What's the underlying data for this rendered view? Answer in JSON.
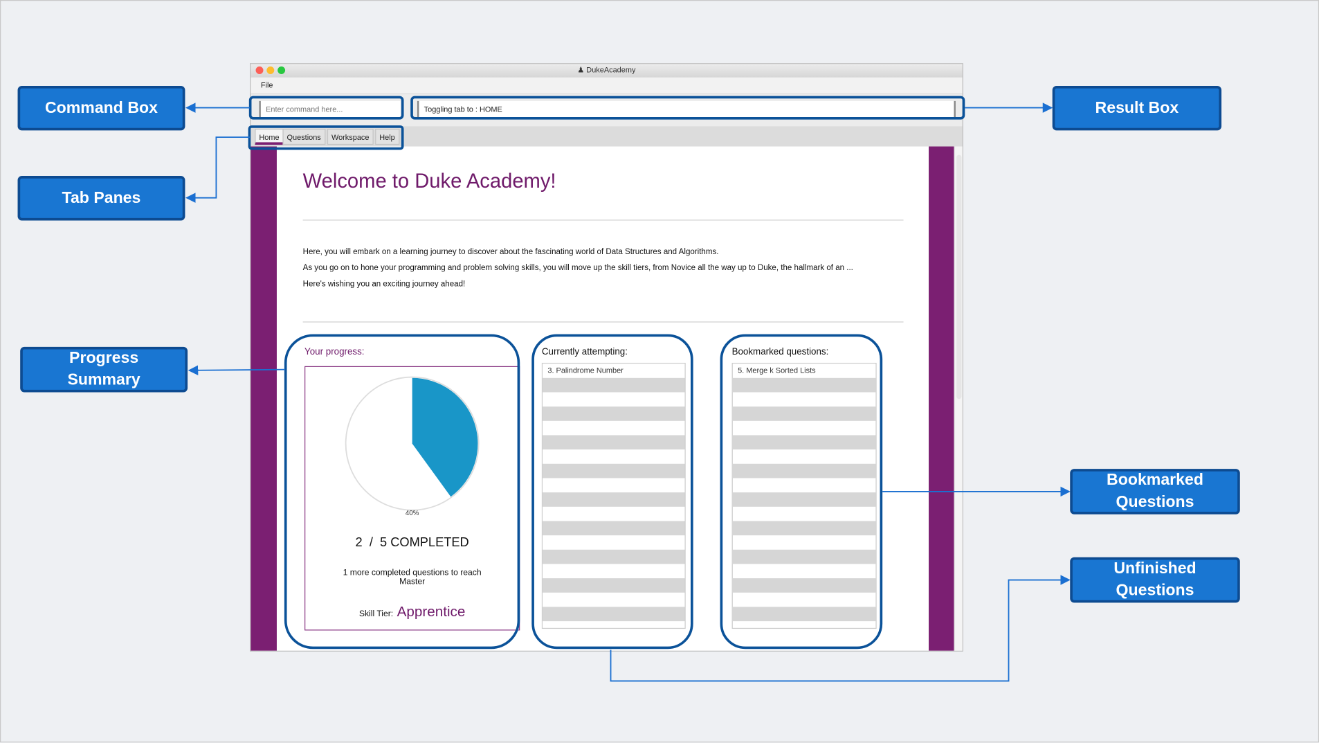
{
  "window": {
    "title": "DukeAcademy",
    "menu": [
      "File"
    ]
  },
  "command_box": {
    "placeholder": "Enter command here...",
    "value": ""
  },
  "result_box": {
    "text": "Toggling tab to : HOME"
  },
  "tabs": [
    {
      "label": "Home",
      "active": true
    },
    {
      "label": "Questions"
    },
    {
      "label": "Workspace"
    },
    {
      "label": "Help"
    }
  ],
  "home": {
    "title": "Welcome to Duke Academy!",
    "paragraphs": [
      "Here, you will embark on a learning journey to discover about the fascinating world of Data Structures and Algorithms.",
      "As you go on to hone your programming and problem solving skills, you will move up the skill tiers, from Novice all the way up to Duke, the hallmark of an ...",
      "Here's wishing you an exciting journey ahead!"
    ],
    "progress": {
      "label": "Your progress:",
      "percent": 40,
      "percent_label": "40%",
      "completed": "2  /  5 COMPLETED",
      "next": "1 more completed questions to reach",
      "next_tier": "Master",
      "tier_label": "Skill Tier:",
      "tier": "Apprentice"
    },
    "attempting": {
      "label": "Currently attempting:",
      "items": [
        "3. Palindrome Number"
      ]
    },
    "bookmarked": {
      "label": "Bookmarked questions:",
      "items": [
        "5. Merge k Sorted Lists"
      ]
    }
  },
  "callouts": {
    "command_box": "Command Box",
    "tab_panes": "Tab Panes",
    "progress_summary": "Progress Summary",
    "result_box": "Result Box",
    "bookmarked": "Bookmarked Questions",
    "unfinished": "Unfinished Questions"
  },
  "colors": {
    "accent": "#7b1f72",
    "pie": "#1996c8",
    "callout": "#1976d2",
    "highlight": "#0b5299"
  }
}
